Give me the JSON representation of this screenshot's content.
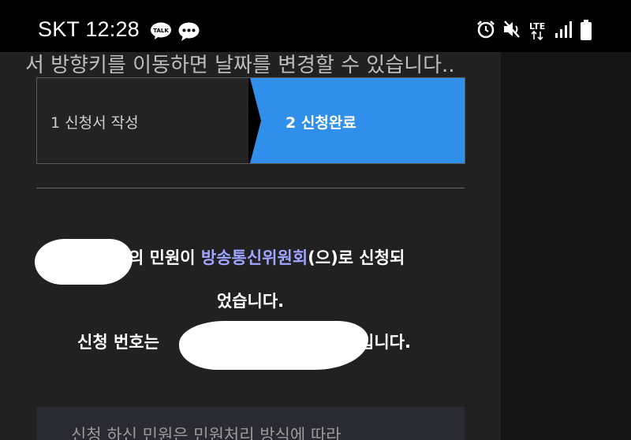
{
  "status_bar": {
    "carrier_time": "SKT 12:28",
    "talk_badge": "TALK",
    "network": "LTE"
  },
  "page": {
    "top_text": "서 방향키를 이동하면 날짜를 변경할 수 있습니다..",
    "steps": [
      {
        "label": "1 신청서 작성"
      },
      {
        "label": "2 신청완료"
      }
    ],
    "message": {
      "line1_pre": "의 민원이 ",
      "line1_link": "방송통신위원회",
      "line1_post": "(으)로 신청되",
      "line2": "었습니다.",
      "line3_pre": "신청 번호는",
      "line3_post": "입니다."
    },
    "bottom_text": "신청 하신 민원은 민원처리 방식에 따라"
  },
  "colors": {
    "accent": "#2f8fea",
    "link": "#9fa5ff"
  }
}
